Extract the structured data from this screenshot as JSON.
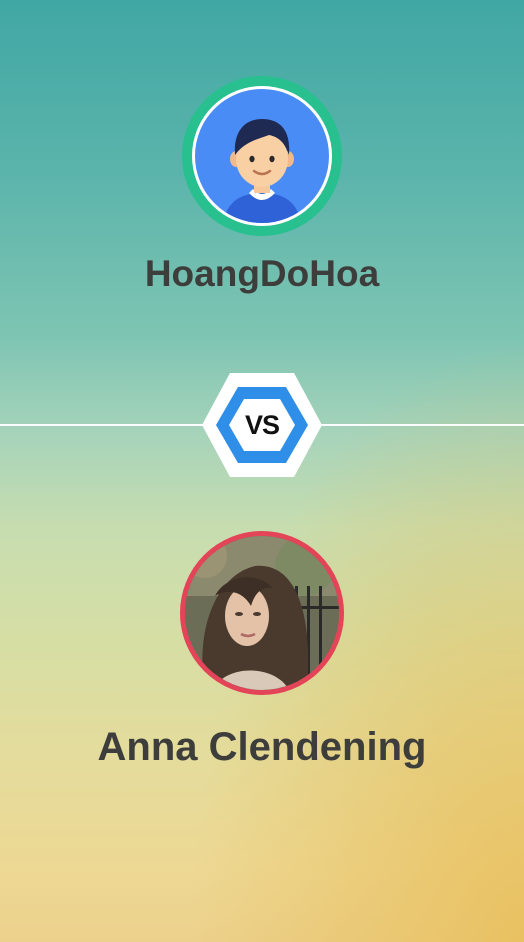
{
  "players": {
    "top": {
      "name": "HoangDoHoa",
      "avatar_icon": "cartoon-boy-avatar-icon",
      "ring_color": "#27c08e"
    },
    "bottom": {
      "name": "Anna Clendening",
      "avatar_icon": "profile-photo",
      "ring_color": "#e44458"
    }
  },
  "versus": {
    "label": "VS",
    "badge_color": "#2f8ee8"
  }
}
